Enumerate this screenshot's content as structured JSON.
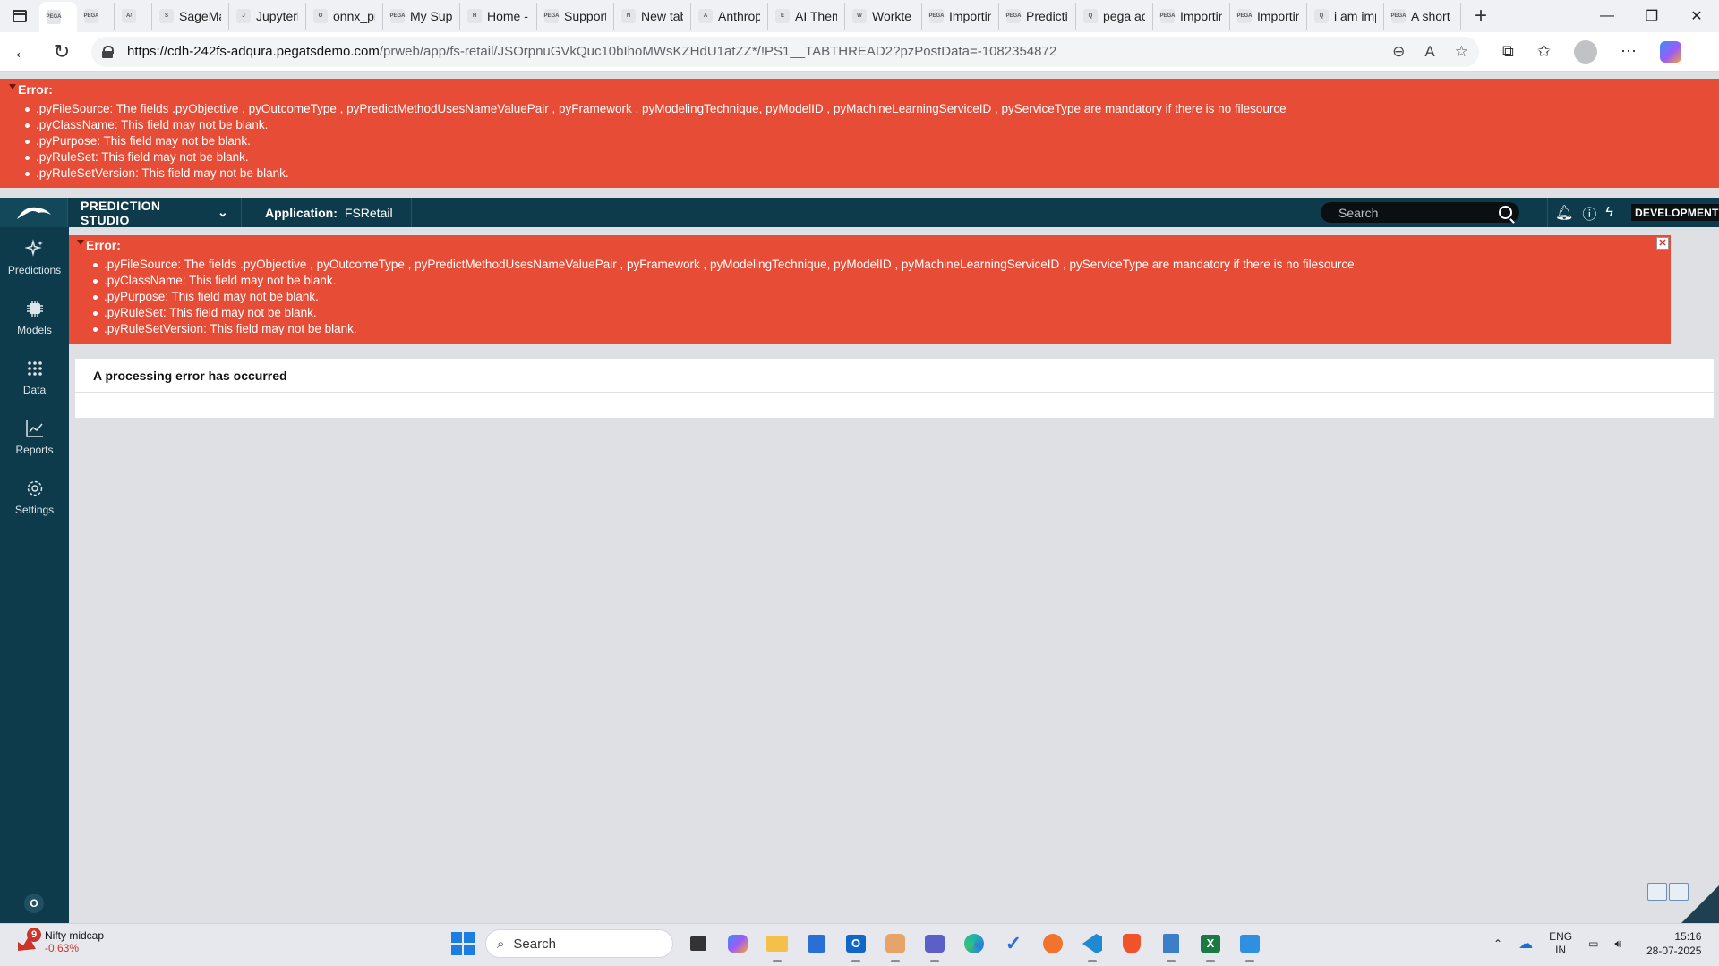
{
  "browser": {
    "tabs": [
      {
        "title": "",
        "favicon": "PEGA",
        "active": true,
        "small": true
      },
      {
        "title": "",
        "favicon": "PEGA",
        "active": false,
        "small": true
      },
      {
        "title": "",
        "favicon": "A/",
        "active": false,
        "small": true
      },
      {
        "title": "SageMa",
        "favicon": "S",
        "active": false
      },
      {
        "title": "Jupyterl",
        "favicon": "J",
        "active": false
      },
      {
        "title": "onnx_pr",
        "favicon": "O",
        "active": false
      },
      {
        "title": "My Supp",
        "favicon": "PEGA",
        "active": false
      },
      {
        "title": "Home -",
        "favicon": "H",
        "active": false
      },
      {
        "title": "Support",
        "favicon": "PEGA",
        "active": false
      },
      {
        "title": "New tab",
        "favicon": "N",
        "active": false
      },
      {
        "title": "Anthrop",
        "favicon": "A",
        "active": false
      },
      {
        "title": "AI Them",
        "favicon": "E",
        "active": false
      },
      {
        "title": "Workte",
        "favicon": "W",
        "active": false
      },
      {
        "title": "Importin",
        "favicon": "PEGA",
        "active": false
      },
      {
        "title": "Predictiv",
        "favicon": "PEGA",
        "active": false
      },
      {
        "title": "pega ac",
        "favicon": "Q",
        "active": false
      },
      {
        "title": "Importin",
        "favicon": "PEGA",
        "active": false
      },
      {
        "title": "Importin",
        "favicon": "PEGA",
        "active": false
      },
      {
        "title": "i am imp",
        "favicon": "Q",
        "active": false
      },
      {
        "title": "A short c",
        "favicon": "PEGA",
        "active": false
      }
    ],
    "url_host": "https://cdh-242fs-adqura.pegatsdemo.com",
    "url_path": "/prweb/app/fs-retail/JSOrpnuGVkQuc10bIhoMWsKZHdU1atZZ*/!PS1__TABTHREAD2?pzPostData=-1082354872"
  },
  "top_error": {
    "title": "Error:",
    "messages": [
      ".pyFileSource: The fields .pyObjective , pyOutcomeType , pyPredictMethodUsesNameValuePair , pyFramework , pyModelingTechnique, pyModelID , pyMachineLearningServiceID , pyServiceType are mandatory if there is no filesource",
      ".pyClassName: This field may not be blank.",
      ".pyPurpose: This field may not be blank.",
      ".pyRuleSet: This field may not be blank.",
      ".pyRuleSetVersion: This field may not be blank."
    ]
  },
  "header": {
    "studio": "PREDICTION STUDIO",
    "app_label": "Application:",
    "app_name": "FSRetail",
    "search_placeholder": "Search",
    "env_badge": "DEVELOPMENT"
  },
  "nav": {
    "items": [
      {
        "label": "Predictions",
        "icon": "sparkle-icon"
      },
      {
        "label": "Models",
        "icon": "chip-icon"
      },
      {
        "label": "Data",
        "icon": "grid-dots-icon"
      },
      {
        "label": "Reports",
        "icon": "line-chart-icon"
      },
      {
        "label": "Settings",
        "icon": "gear-icon"
      }
    ],
    "user_initial": "O"
  },
  "inner_error": {
    "title": "Error:",
    "messages": [
      ".pyFileSource: The fields .pyObjective , pyOutcomeType , pyPredictMethodUsesNameValuePair , pyFramework , pyModelingTechnique, pyModelID , pyMachineLearningServiceID , pyServiceType are mandatory if there is no filesource",
      ".pyClassName: This field may not be blank.",
      ".pyPurpose: This field may not be blank.",
      ".pyRuleSet: This field may not be blank.",
      ".pyRuleSetVersion: This field may not be blank."
    ]
  },
  "panel": {
    "message": "A processing error has occurred"
  },
  "taskbar": {
    "widget_badge": "9",
    "widget_title": "Nifty midcap",
    "widget_value": "-0.63%",
    "search_placeholder": "Search",
    "lang_line1": "ENG",
    "lang_line2": "IN",
    "time": "15:16",
    "date": "28-07-2025"
  },
  "colors": {
    "error_red": "#e64c36",
    "pega_header": "#0e3b4b",
    "page_bg": "#dfe0e4"
  }
}
